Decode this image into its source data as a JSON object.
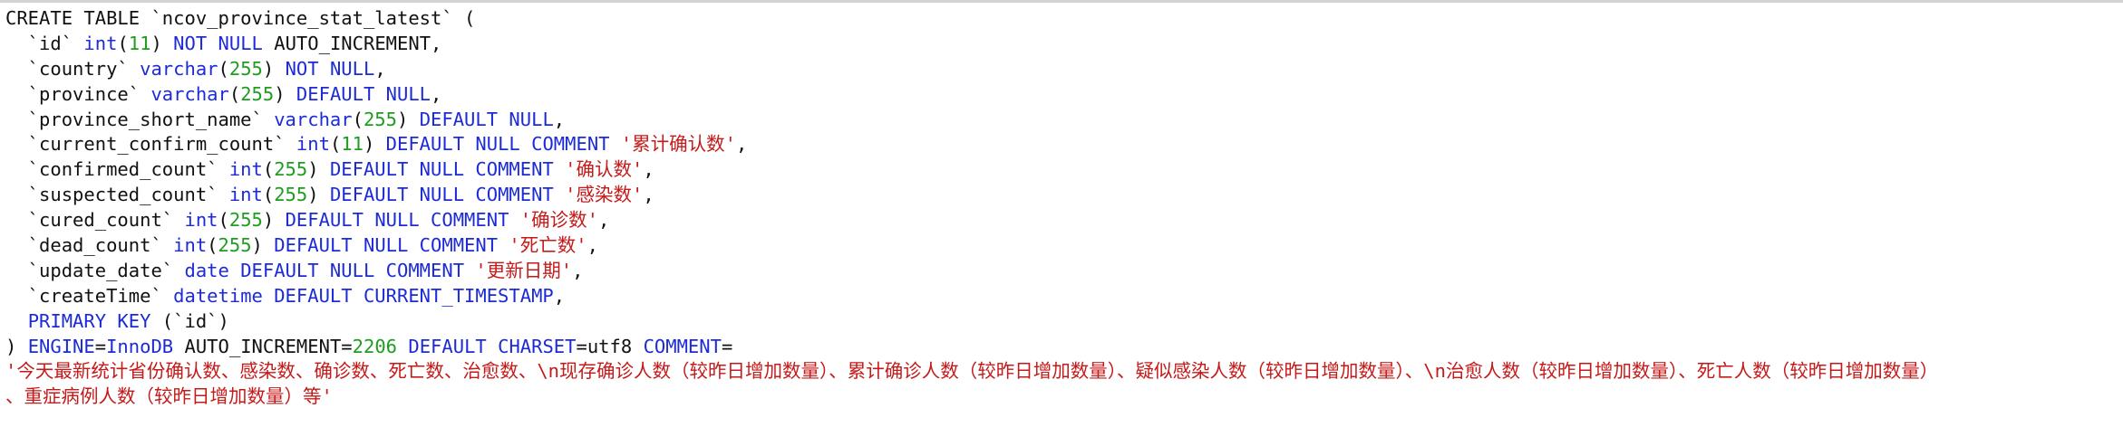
{
  "sql": [
    [
      [
        "d",
        "CREATE TABLE `ncov_province_stat_latest` ("
      ]
    ],
    [
      [
        "d",
        "  `id` "
      ],
      [
        "k",
        "int"
      ],
      [
        "d",
        "("
      ],
      [
        "n",
        "11"
      ],
      [
        "d",
        ") "
      ],
      [
        "k",
        "NOT NULL"
      ],
      [
        "d",
        " AUTO_INCREMENT,"
      ]
    ],
    [
      [
        "d",
        "  `country` "
      ],
      [
        "k",
        "varchar"
      ],
      [
        "d",
        "("
      ],
      [
        "n",
        "255"
      ],
      [
        "d",
        ") "
      ],
      [
        "k",
        "NOT NULL"
      ],
      [
        "d",
        ","
      ]
    ],
    [
      [
        "d",
        "  `province` "
      ],
      [
        "k",
        "varchar"
      ],
      [
        "d",
        "("
      ],
      [
        "n",
        "255"
      ],
      [
        "d",
        ") "
      ],
      [
        "k",
        "DEFAULT NULL"
      ],
      [
        "d",
        ","
      ]
    ],
    [
      [
        "d",
        "  `province_short_name` "
      ],
      [
        "k",
        "varchar"
      ],
      [
        "d",
        "("
      ],
      [
        "n",
        "255"
      ],
      [
        "d",
        ") "
      ],
      [
        "k",
        "DEFAULT NULL"
      ],
      [
        "d",
        ","
      ]
    ],
    [
      [
        "d",
        "  `current_confirm_count` "
      ],
      [
        "k",
        "int"
      ],
      [
        "d",
        "("
      ],
      [
        "n",
        "11"
      ],
      [
        "d",
        ") "
      ],
      [
        "k",
        "DEFAULT NULL COMMENT"
      ],
      [
        "d",
        " "
      ],
      [
        "s",
        "'累计确认数'"
      ],
      [
        "d",
        ","
      ]
    ],
    [
      [
        "d",
        "  `confirmed_count` "
      ],
      [
        "k",
        "int"
      ],
      [
        "d",
        "("
      ],
      [
        "n",
        "255"
      ],
      [
        "d",
        ") "
      ],
      [
        "k",
        "DEFAULT NULL COMMENT"
      ],
      [
        "d",
        " "
      ],
      [
        "s",
        "'确认数'"
      ],
      [
        "d",
        ","
      ]
    ],
    [
      [
        "d",
        "  `suspected_count` "
      ],
      [
        "k",
        "int"
      ],
      [
        "d",
        "("
      ],
      [
        "n",
        "255"
      ],
      [
        "d",
        ") "
      ],
      [
        "k",
        "DEFAULT NULL COMMENT"
      ],
      [
        "d",
        " "
      ],
      [
        "s",
        "'感染数'"
      ],
      [
        "d",
        ","
      ]
    ],
    [
      [
        "d",
        "  `cured_count` "
      ],
      [
        "k",
        "int"
      ],
      [
        "d",
        "("
      ],
      [
        "n",
        "255"
      ],
      [
        "d",
        ") "
      ],
      [
        "k",
        "DEFAULT NULL COMMENT"
      ],
      [
        "d",
        " "
      ],
      [
        "s",
        "'确诊数'"
      ],
      [
        "d",
        ","
      ]
    ],
    [
      [
        "d",
        "  `dead_count` "
      ],
      [
        "k",
        "int"
      ],
      [
        "d",
        "("
      ],
      [
        "n",
        "255"
      ],
      [
        "d",
        ") "
      ],
      [
        "k",
        "DEFAULT NULL COMMENT"
      ],
      [
        "d",
        " "
      ],
      [
        "s",
        "'死亡数'"
      ],
      [
        "d",
        ","
      ]
    ],
    [
      [
        "d",
        "  `update_date` "
      ],
      [
        "k",
        "date DEFAULT NULL COMMENT"
      ],
      [
        "d",
        " "
      ],
      [
        "s",
        "'更新日期'"
      ],
      [
        "d",
        ","
      ]
    ],
    [
      [
        "d",
        "  `createTime` "
      ],
      [
        "k",
        "datetime DEFAULT CURRENT_TIMESTAMP"
      ],
      [
        "d",
        ","
      ]
    ],
    [
      [
        "d",
        "  "
      ],
      [
        "k",
        "PRIMARY KEY"
      ],
      [
        "d",
        " (`id`)"
      ]
    ],
    [
      [
        "d",
        ") "
      ],
      [
        "k",
        "ENGINE"
      ],
      [
        "d",
        "="
      ],
      [
        "k",
        "InnoDB"
      ],
      [
        "d",
        " AUTO_INCREMENT="
      ],
      [
        "n",
        "2206"
      ],
      [
        "d",
        " "
      ],
      [
        "k",
        "DEFAULT CHARSET"
      ],
      [
        "d",
        "=utf8 "
      ],
      [
        "k",
        "COMMENT"
      ],
      [
        "d",
        "="
      ]
    ],
    [
      [
        "s",
        "'今天最新统计省份确认数、感染数、确诊数、死亡数、治愈数、\\n现存确诊人数（较昨日增加数量）、累计确诊人数（较昨日增加数量）、疑似感染人数（较昨日增加数量）、\\n治愈人数（较昨日增加数量）、死亡人数（较昨日增加数量）"
      ]
    ],
    [
      [
        "s",
        "、重症病例人数（较昨日增加数量）等'"
      ]
    ]
  ]
}
